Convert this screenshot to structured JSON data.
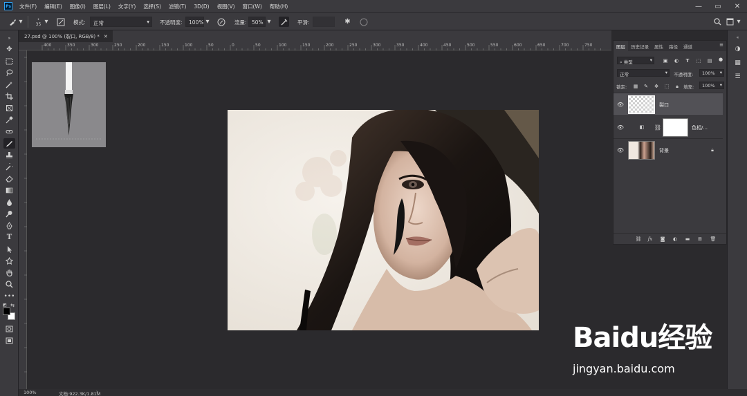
{
  "app": {
    "logo": "Ps"
  },
  "menu": [
    "文件(F)",
    "编辑(E)",
    "图像(I)",
    "图层(L)",
    "文字(Y)",
    "选择(S)",
    "滤镜(T)",
    "3D(D)",
    "视图(V)",
    "窗口(W)",
    "帮助(H)"
  ],
  "options": {
    "brush_size": "35",
    "mode_label": "模式:",
    "mode_value": "正常",
    "opacity_label": "不透明度:",
    "opacity_value": "100%",
    "flow_label": "流量:",
    "flow_value": "50%",
    "smoothing_label": "平滑:"
  },
  "document": {
    "tab_title": "27.psd @ 100% (裂口, RGB/8) *"
  },
  "ruler": {
    "ticks": [
      "400",
      "350",
      "300",
      "250",
      "200",
      "150",
      "100",
      "50",
      "0",
      "50",
      "100",
      "150",
      "200",
      "250",
      "300",
      "350",
      "400",
      "450",
      "500",
      "550",
      "600",
      "650",
      "700",
      "750"
    ]
  },
  "layers_panel": {
    "tabs": [
      "图层",
      "历史记录",
      "属性",
      "路径",
      "通道"
    ],
    "filter_value": "类型",
    "blend_mode": "正常",
    "opacity_label": "不透明度:",
    "opacity_value": "100%",
    "lock_label": "锁定:",
    "fill_label": "填充:",
    "fill_value": "100%",
    "layers": [
      {
        "name": "裂口"
      },
      {
        "name": "色相/..."
      },
      {
        "name": "背景"
      }
    ]
  },
  "status": {
    "zoom": "100%",
    "doc_info": "文档:922.3K/1.81M"
  },
  "watermark": {
    "brand": "Baidu经验",
    "url": "jingyan.baidu.com"
  },
  "colors": {
    "app_bg": "#2b2a2d",
    "panel_bg": "#3b3a3e",
    "accent": "#31a8ff"
  }
}
